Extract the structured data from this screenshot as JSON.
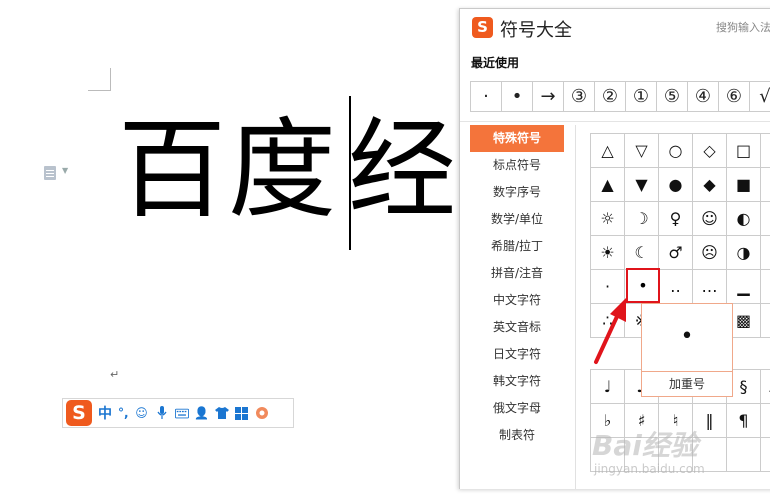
{
  "document": {
    "text_before": "百度",
    "text_after": "经",
    "paragraph_mark": "↵"
  },
  "ime_toolbar": {
    "logo": "S",
    "mode": "中",
    "punct": "°,",
    "icons": [
      "smiley-icon",
      "microphone-icon",
      "keyboard-icon",
      "user-icon",
      "shirt-icon",
      "grid-icon",
      "tools-icon"
    ]
  },
  "dialog": {
    "logo": "S",
    "title": "符号大全",
    "link": "搜狗输入法",
    "recent_title": "最近使用",
    "recent": [
      "·",
      "•",
      "→",
      "③",
      "②",
      "①",
      "⑤",
      "④",
      "⑥",
      "√"
    ],
    "categories": [
      "特殊符号",
      "标点符号",
      "数字序号",
      "数学/单位",
      "希腊/拉丁",
      "拼音/注音",
      "中文字符",
      "英文音标",
      "日文字符",
      "韩文字符",
      "俄文字母",
      "制表符"
    ],
    "active_category": "特殊符号",
    "grid": [
      [
        "△",
        "▽",
        "○",
        "◇",
        "□",
        "☆"
      ],
      [
        "▲",
        "▼",
        "●",
        "◆",
        "■",
        "★"
      ],
      [
        "☼",
        "☽",
        "♀",
        "☺",
        "◐",
        "☑"
      ],
      [
        "☀",
        "☾",
        "♂",
        "☹",
        "◑",
        "☒"
      ],
      [
        "·",
        "•",
        "‥",
        "…",
        "▁",
        "▂"
      ],
      [
        "∴",
        "※",
        "",
        "",
        "▩",
        "▓"
      ]
    ],
    "grid2": [
      [
        "♩",
        "♪",
        "",
        "",
        "§",
        "№"
      ],
      [
        "♭",
        "♯",
        "♮",
        "‖",
        "¶",
        "€"
      ],
      [
        "",
        "",
        "",
        "",
        "",
        ""
      ]
    ],
    "highlighted_symbol": "•",
    "tooltip_symbol": "•",
    "tooltip_name": "加重号"
  },
  "colors": {
    "accent": "#f4743b",
    "logo": "#ef5a1e",
    "highlight": "#e0141b"
  }
}
